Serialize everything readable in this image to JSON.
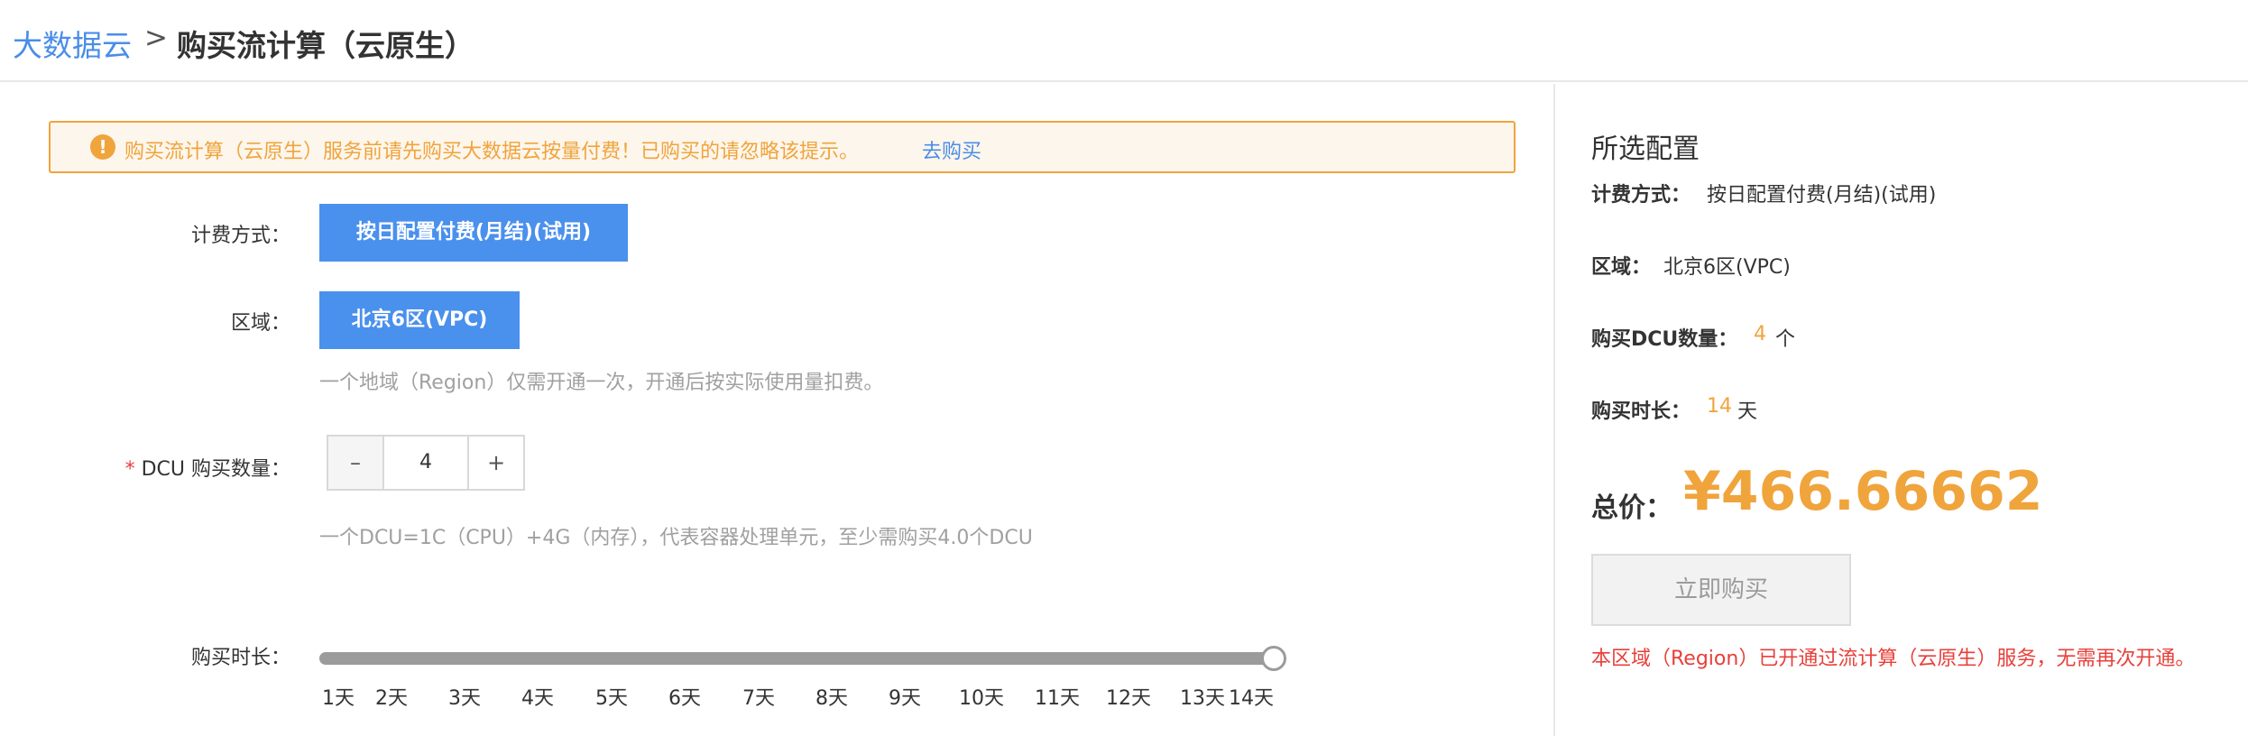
{
  "breadcrumb": {
    "root": "大数据云",
    "separator": ">",
    "current": "购买流计算（云原生）"
  },
  "alert": {
    "icon": "exclamation-circle-icon",
    "text": "购买流计算（云原生）服务前请先购买大数据云按量付费！已购买的请忽略该提示。",
    "link": "去购买"
  },
  "form": {
    "billing_label": "计费方式：",
    "billing_option": "按日配置付费(月结)(试用)",
    "region_label": "区域：",
    "region_option": "北京6区(VPC)",
    "region_hint": "一个地域（Region）仅需开通一次，开通后按实际使用量扣费。",
    "dcu_required_mark": "*",
    "dcu_label": "DCU 购买数量：",
    "dcu_minus": "–",
    "dcu_value": "4",
    "dcu_plus": "+",
    "dcu_hint": "一个DCU=1C（CPU）+4G（内存），代表容器处理单元，至少需购买4.0个DCU",
    "duration_label": "购买时长：",
    "duration_ticks": [
      "1天",
      "2天",
      "3天",
      "4天",
      "5天",
      "6天",
      "7天",
      "8天",
      "9天",
      "10天",
      "11天",
      "12天",
      "13天",
      "14天"
    ],
    "duration_selected_fraction": 1.0
  },
  "summary": {
    "title": "所选配置",
    "billing_label": "计费方式：",
    "billing_value": "按日配置付费(月结)(试用)",
    "region_label": "区域：",
    "region_value": "北京6区(VPC)",
    "dcu_label": "购买DCU数量：",
    "dcu_value": "4",
    "dcu_unit": "个",
    "duration_label": "购买时长：",
    "duration_value": "14",
    "duration_unit": "天",
    "total_label": "总价：",
    "total_price": "¥466.66662",
    "buy_button": "立即购买",
    "notice": "本区域（Region）已开通过流计算（云原生）服务，无需再次开通。"
  },
  "colors": {
    "accent_blue": "#4a90ed",
    "warning_orange": "#f0a43c",
    "error_red": "#e8403a"
  }
}
